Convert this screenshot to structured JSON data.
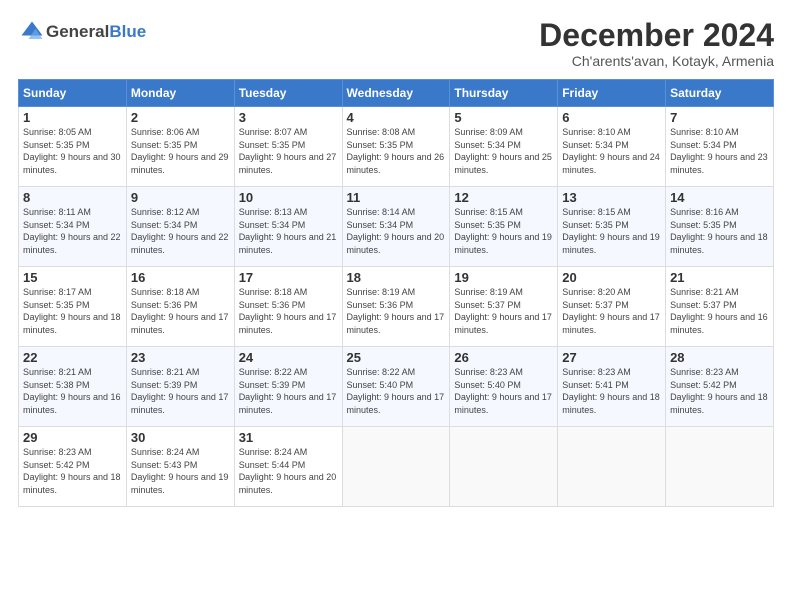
{
  "header": {
    "logo_general": "General",
    "logo_blue": "Blue",
    "title": "December 2024",
    "subtitle": "Ch'arents'avan, Kotayk, Armenia"
  },
  "columns": [
    "Sunday",
    "Monday",
    "Tuesday",
    "Wednesday",
    "Thursday",
    "Friday",
    "Saturday"
  ],
  "weeks": [
    [
      {
        "day": "1",
        "sunrise": "Sunrise: 8:05 AM",
        "sunset": "Sunset: 5:35 PM",
        "daylight": "Daylight: 9 hours and 30 minutes."
      },
      {
        "day": "2",
        "sunrise": "Sunrise: 8:06 AM",
        "sunset": "Sunset: 5:35 PM",
        "daylight": "Daylight: 9 hours and 29 minutes."
      },
      {
        "day": "3",
        "sunrise": "Sunrise: 8:07 AM",
        "sunset": "Sunset: 5:35 PM",
        "daylight": "Daylight: 9 hours and 27 minutes."
      },
      {
        "day": "4",
        "sunrise": "Sunrise: 8:08 AM",
        "sunset": "Sunset: 5:35 PM",
        "daylight": "Daylight: 9 hours and 26 minutes."
      },
      {
        "day": "5",
        "sunrise": "Sunrise: 8:09 AM",
        "sunset": "Sunset: 5:34 PM",
        "daylight": "Daylight: 9 hours and 25 minutes."
      },
      {
        "day": "6",
        "sunrise": "Sunrise: 8:10 AM",
        "sunset": "Sunset: 5:34 PM",
        "daylight": "Daylight: 9 hours and 24 minutes."
      },
      {
        "day": "7",
        "sunrise": "Sunrise: 8:10 AM",
        "sunset": "Sunset: 5:34 PM",
        "daylight": "Daylight: 9 hours and 23 minutes."
      }
    ],
    [
      {
        "day": "8",
        "sunrise": "Sunrise: 8:11 AM",
        "sunset": "Sunset: 5:34 PM",
        "daylight": "Daylight: 9 hours and 22 minutes."
      },
      {
        "day": "9",
        "sunrise": "Sunrise: 8:12 AM",
        "sunset": "Sunset: 5:34 PM",
        "daylight": "Daylight: 9 hours and 22 minutes."
      },
      {
        "day": "10",
        "sunrise": "Sunrise: 8:13 AM",
        "sunset": "Sunset: 5:34 PM",
        "daylight": "Daylight: 9 hours and 21 minutes."
      },
      {
        "day": "11",
        "sunrise": "Sunrise: 8:14 AM",
        "sunset": "Sunset: 5:34 PM",
        "daylight": "Daylight: 9 hours and 20 minutes."
      },
      {
        "day": "12",
        "sunrise": "Sunrise: 8:15 AM",
        "sunset": "Sunset: 5:35 PM",
        "daylight": "Daylight: 9 hours and 19 minutes."
      },
      {
        "day": "13",
        "sunrise": "Sunrise: 8:15 AM",
        "sunset": "Sunset: 5:35 PM",
        "daylight": "Daylight: 9 hours and 19 minutes."
      },
      {
        "day": "14",
        "sunrise": "Sunrise: 8:16 AM",
        "sunset": "Sunset: 5:35 PM",
        "daylight": "Daylight: 9 hours and 18 minutes."
      }
    ],
    [
      {
        "day": "15",
        "sunrise": "Sunrise: 8:17 AM",
        "sunset": "Sunset: 5:35 PM",
        "daylight": "Daylight: 9 hours and 18 minutes."
      },
      {
        "day": "16",
        "sunrise": "Sunrise: 8:18 AM",
        "sunset": "Sunset: 5:36 PM",
        "daylight": "Daylight: 9 hours and 17 minutes."
      },
      {
        "day": "17",
        "sunrise": "Sunrise: 8:18 AM",
        "sunset": "Sunset: 5:36 PM",
        "daylight": "Daylight: 9 hours and 17 minutes."
      },
      {
        "day": "18",
        "sunrise": "Sunrise: 8:19 AM",
        "sunset": "Sunset: 5:36 PM",
        "daylight": "Daylight: 9 hours and 17 minutes."
      },
      {
        "day": "19",
        "sunrise": "Sunrise: 8:19 AM",
        "sunset": "Sunset: 5:37 PM",
        "daylight": "Daylight: 9 hours and 17 minutes."
      },
      {
        "day": "20",
        "sunrise": "Sunrise: 8:20 AM",
        "sunset": "Sunset: 5:37 PM",
        "daylight": "Daylight: 9 hours and 17 minutes."
      },
      {
        "day": "21",
        "sunrise": "Sunrise: 8:21 AM",
        "sunset": "Sunset: 5:37 PM",
        "daylight": "Daylight: 9 hours and 16 minutes."
      }
    ],
    [
      {
        "day": "22",
        "sunrise": "Sunrise: 8:21 AM",
        "sunset": "Sunset: 5:38 PM",
        "daylight": "Daylight: 9 hours and 16 minutes."
      },
      {
        "day": "23",
        "sunrise": "Sunrise: 8:21 AM",
        "sunset": "Sunset: 5:39 PM",
        "daylight": "Daylight: 9 hours and 17 minutes."
      },
      {
        "day": "24",
        "sunrise": "Sunrise: 8:22 AM",
        "sunset": "Sunset: 5:39 PM",
        "daylight": "Daylight: 9 hours and 17 minutes."
      },
      {
        "day": "25",
        "sunrise": "Sunrise: 8:22 AM",
        "sunset": "Sunset: 5:40 PM",
        "daylight": "Daylight: 9 hours and 17 minutes."
      },
      {
        "day": "26",
        "sunrise": "Sunrise: 8:23 AM",
        "sunset": "Sunset: 5:40 PM",
        "daylight": "Daylight: 9 hours and 17 minutes."
      },
      {
        "day": "27",
        "sunrise": "Sunrise: 8:23 AM",
        "sunset": "Sunset: 5:41 PM",
        "daylight": "Daylight: 9 hours and 18 minutes."
      },
      {
        "day": "28",
        "sunrise": "Sunrise: 8:23 AM",
        "sunset": "Sunset: 5:42 PM",
        "daylight": "Daylight: 9 hours and 18 minutes."
      }
    ],
    [
      {
        "day": "29",
        "sunrise": "Sunrise: 8:23 AM",
        "sunset": "Sunset: 5:42 PM",
        "daylight": "Daylight: 9 hours and 18 minutes."
      },
      {
        "day": "30",
        "sunrise": "Sunrise: 8:24 AM",
        "sunset": "Sunset: 5:43 PM",
        "daylight": "Daylight: 9 hours and 19 minutes."
      },
      {
        "day": "31",
        "sunrise": "Sunrise: 8:24 AM",
        "sunset": "Sunset: 5:44 PM",
        "daylight": "Daylight: 9 hours and 20 minutes."
      },
      null,
      null,
      null,
      null
    ]
  ]
}
